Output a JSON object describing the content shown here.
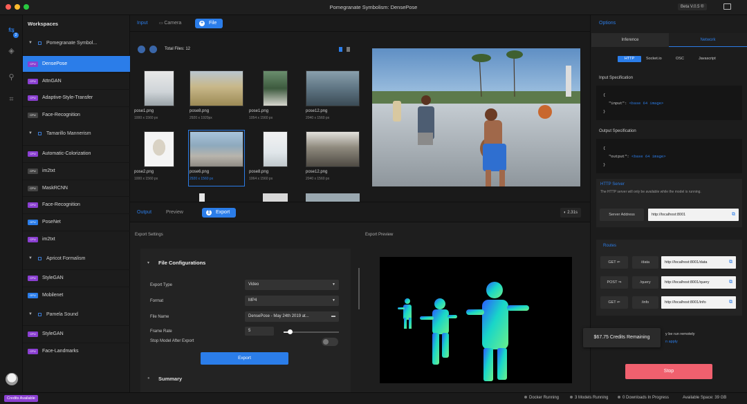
{
  "window": {
    "title": "Pomegranate Symbolism: DensePose",
    "beta": "Beta V.0.5 ®"
  },
  "sidebar": {
    "title": "Workspaces",
    "groups": [
      {
        "label": "Pomegranate Symbol...",
        "items": [
          {
            "badge": "CPU",
            "label": "DensePose",
            "selected": true
          },
          {
            "badge": "CPU",
            "label": "AttnGAN"
          },
          {
            "badge": "CPU",
            "label": "Adaptive-Style-Transfer"
          },
          {
            "badge": "CPU",
            "label": "Face-Recognition"
          }
        ]
      },
      {
        "label": "Tamarillo Mannerism",
        "items": [
          {
            "badge": "CPU",
            "label": "Automatic-Colorization"
          },
          {
            "badge": "CPU",
            "label": "im2txt"
          },
          {
            "badge": "CPU",
            "label": "MaskRCNN"
          },
          {
            "badge": "CPU",
            "label": "Face-Recognition"
          },
          {
            "badge": "GPU",
            "label": "PoseNet"
          },
          {
            "badge": "CPU",
            "label": "im2txt"
          }
        ]
      },
      {
        "label": "Apricot Formalism",
        "items": [
          {
            "badge": "CPU",
            "label": "StyleGAN"
          },
          {
            "badge": "GPU",
            "label": "Mobilenet"
          }
        ]
      },
      {
        "label": "Pamela Sound",
        "items": [
          {
            "badge": "CPU",
            "label": "StyleGAN"
          },
          {
            "badge": "CPU",
            "label": "Face-Landmarks"
          }
        ]
      }
    ]
  },
  "input": {
    "label": "Input",
    "tab_camera": "Camera",
    "tab_file": "File"
  },
  "files": {
    "total": "Total Files: 12",
    "items": [
      {
        "name": "pose1.png",
        "size": "1000 x 1560 px"
      },
      {
        "name": "pose8.png",
        "size": "2920 x 1920px"
      },
      {
        "name": "pose1.png",
        "size": "1054 x 1560 px"
      },
      {
        "name": "pose12.png",
        "size": "2040 x 1560 px"
      },
      {
        "name": "pose2.png",
        "size": "1000 x 1560 px"
      },
      {
        "name": "pose6.png",
        "size": "2920 x 1560 px"
      },
      {
        "name": "pose8.png",
        "size": "1064 x 1560 px"
      },
      {
        "name": "pose12.png",
        "size": "2040 x 1560 px"
      }
    ]
  },
  "output": {
    "label": "Output",
    "tab_preview": "Preview",
    "tab_export": "Export",
    "time": "2.31s"
  },
  "export_settings": {
    "header": "Export Settings",
    "section": "File Configurations",
    "export_type_label": "Export Type",
    "export_type_value": "Video",
    "format_label": "Format",
    "format_value": "MP4",
    "file_name_label": "File Name",
    "file_name_value": "DensePose - May 24th 2019 at...",
    "frame_rate_label": "Frame Rate",
    "frame_rate_value": "5",
    "stop_label": "Stop Model After Export",
    "export_button": "Export",
    "summary": "Summary",
    "frame_rate_fraction": 0.12
  },
  "export_preview": {
    "header": "Export Preview"
  },
  "options": {
    "title": "Options",
    "tab_inference": "Inference",
    "tab_network": "Network",
    "protocols": [
      "HTTP",
      "Socket.io",
      "OSC",
      "Javascript"
    ],
    "input_spec": {
      "label": "Input Specification",
      "key": "\"input\"",
      "value": "<base 64 image>"
    },
    "output_spec": {
      "label": "Output Specification",
      "key": "\"output\"",
      "value": "<base 64 image>"
    },
    "http_server": {
      "label": "HTTP Server",
      "desc": "The HTTP server will only be available while the model is running.",
      "address_label": "Server Address",
      "address": "http://localhost:8001"
    },
    "routes": {
      "label": "Routes",
      "items": [
        {
          "method": "GET",
          "path": "/data",
          "url": "http://localhost:8001/data"
        },
        {
          "method": "POST",
          "path": "/query",
          "url": "http://localhost:8001/query"
        },
        {
          "method": "GET",
          "path": "/info",
          "url": "http://localhost:8001/info"
        }
      ]
    },
    "credits": "$67.75 Credits Remaining",
    "remote_line1": "y be run remotely",
    "remote_line2": "n apply",
    "stop_button": "Stop"
  },
  "status": {
    "credits_badge": "Credits Available",
    "docker": "Docker Running",
    "models": "3 Models Running",
    "downloads": "0 Downloads In Progress",
    "space": "Available Space: 39 GB"
  },
  "colors": {
    "accent": "#2b7de9",
    "cpu_badge": "#8a3fd1",
    "gpu_badge": "#2b7de9",
    "stop": "#f0606e"
  }
}
